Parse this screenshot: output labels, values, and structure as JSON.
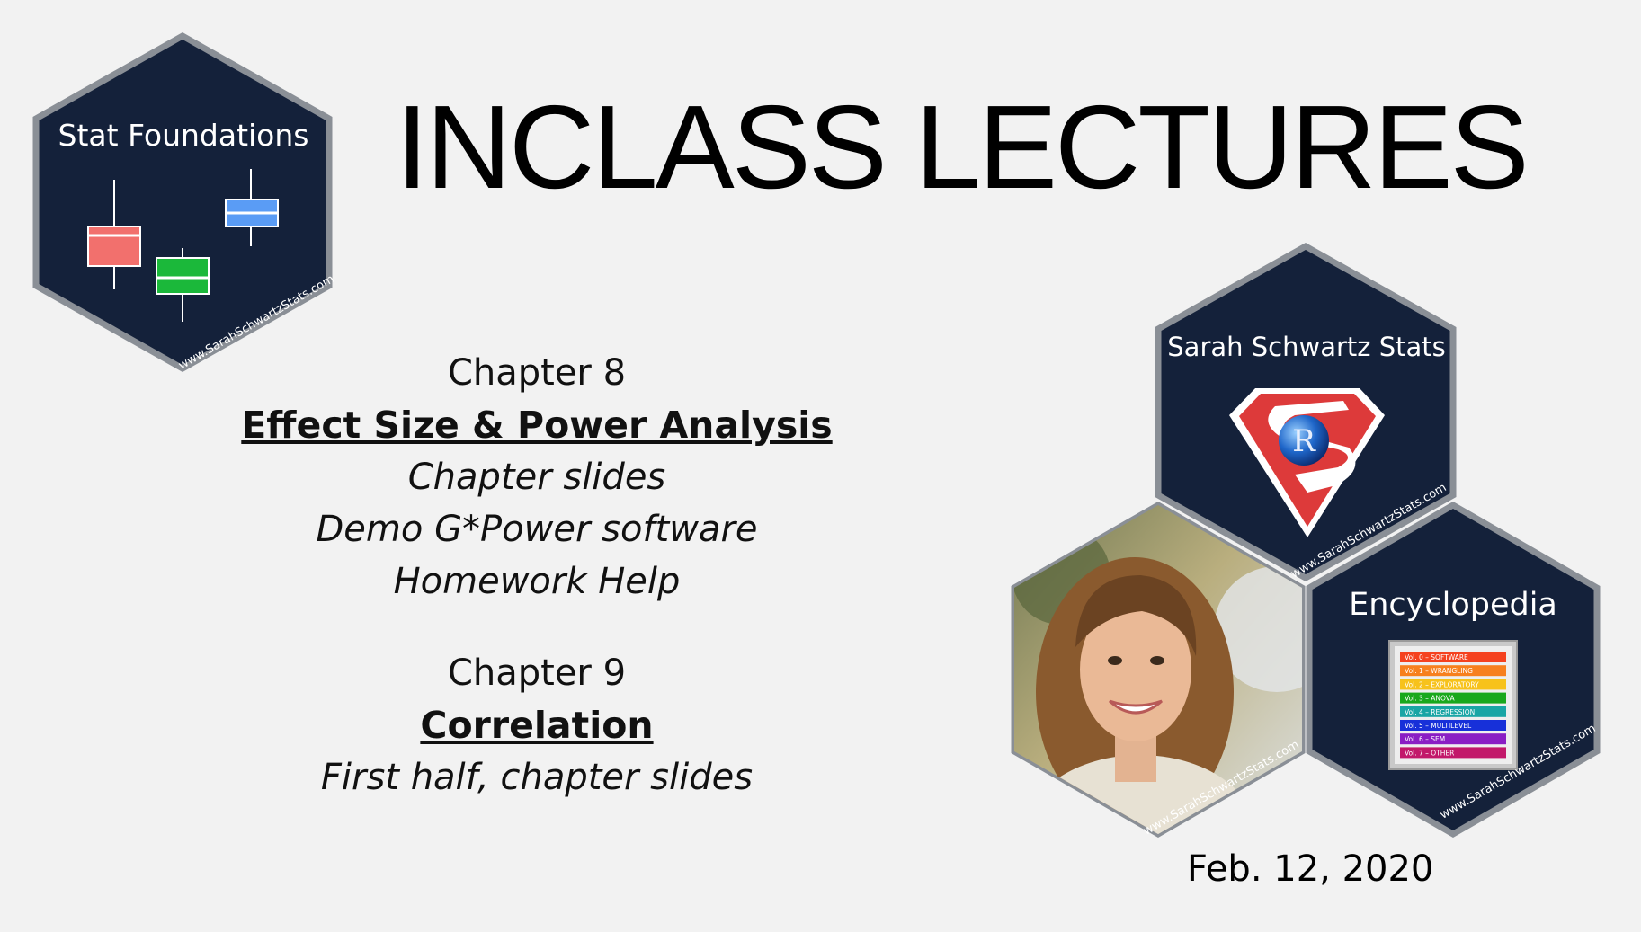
{
  "title": "INCLASS LECTURES",
  "chapter8": {
    "heading": "Chapter 8",
    "topic": "Effect Size & Power Analysis",
    "items": [
      "Chapter slides",
      "Demo G*Power software",
      "Homework Help"
    ]
  },
  "chapter9": {
    "heading": "Chapter 9",
    "topic": "Correlation",
    "items": [
      "First half, chapter slides"
    ]
  },
  "date": "Feb. 12, 2020",
  "hex_stat": {
    "label": "Stat Foundations",
    "url": "www.SarahSchwartzStats.com"
  },
  "hex_brand": {
    "label": "Sarah Schwartz Stats",
    "logo_letter": "R",
    "url": "www.SarahSchwartzStats.com"
  },
  "hex_photo": {
    "url": "www.SarahSchwartzStats.com"
  },
  "hex_encyclopedia": {
    "label": "Encyclopedia",
    "url": "www.SarahSchwartzStats.com",
    "volumes": [
      {
        "label": "Vol. 0 – SOFTWARE",
        "color": "#f5421f"
      },
      {
        "label": "Vol. 1 – WRANGLING",
        "color": "#f7801e"
      },
      {
        "label": "Vol. 2 – EXPLORATORY",
        "color": "#f7c21b"
      },
      {
        "label": "Vol. 3 – ANOVA",
        "color": "#19a81d"
      },
      {
        "label": "Vol. 4 – REGRESSION",
        "color": "#19a5a5"
      },
      {
        "label": "Vol. 5 – MULTILEVEL",
        "color": "#1730d9"
      },
      {
        "label": "Vol. 6 – SEM",
        "color": "#8a1ec4"
      },
      {
        "label": "Vol. 7 – OTHER",
        "color": "#c2186a"
      }
    ]
  },
  "colors": {
    "hex_fill": "#14213a",
    "hex_border": "#8a8f96",
    "background": "#f2f2f2"
  }
}
